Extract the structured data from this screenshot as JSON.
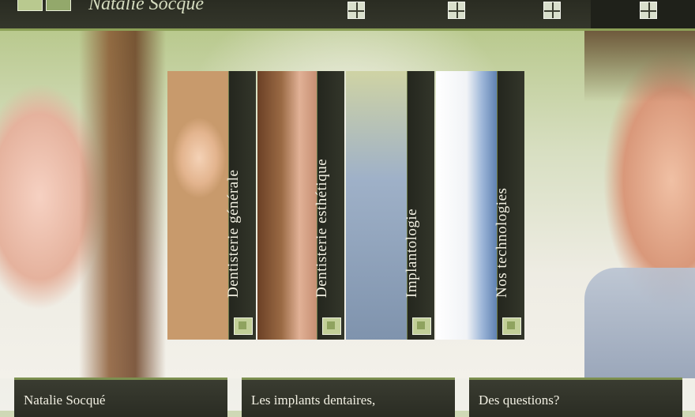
{
  "header": {
    "logo_text": "Natalie Socqué",
    "nav_icons": [
      "nav-square-icon",
      "nav-square-icon",
      "nav-square-icon",
      "nav-square-icon"
    ]
  },
  "panels": [
    {
      "label": "Dentisterie générale"
    },
    {
      "label": "Dentisterie esthétique"
    },
    {
      "label": "Implantologie"
    },
    {
      "label": "Nos technologies"
    }
  ],
  "info_boxes": [
    {
      "title": "Natalie Socqué"
    },
    {
      "title": "Les implants dentaires,"
    },
    {
      "title": "Des questions?"
    }
  ],
  "colors": {
    "header_bg": "#2a2c22",
    "accent_green": "#8ca057",
    "panel_strip": "#24261e",
    "text_light": "#f2f0e2"
  }
}
